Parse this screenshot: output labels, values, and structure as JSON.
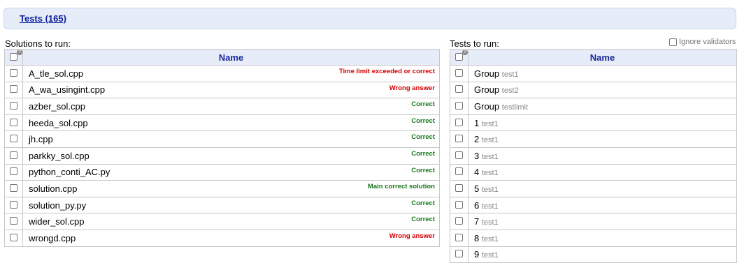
{
  "header": {
    "tests_link": "Tests (165)"
  },
  "solutions": {
    "caption": "Solutions to run:",
    "column_header": "Name",
    "rows": [
      {
        "name": "A_tle_sol.cpp",
        "verdict": "Time limit exceeded or correct",
        "color": "#d40000"
      },
      {
        "name": "A_wa_usingint.cpp",
        "verdict": "Wrong answer",
        "color": "#d40000"
      },
      {
        "name": "azber_sol.cpp",
        "verdict": "Correct",
        "color": "#17751a"
      },
      {
        "name": "heeda_sol.cpp",
        "verdict": "Correct",
        "color": "#17751a"
      },
      {
        "name": "jh.cpp",
        "verdict": "Correct",
        "color": "#17751a"
      },
      {
        "name": "parkky_sol.cpp",
        "verdict": "Correct",
        "color": "#17751a"
      },
      {
        "name": "python_conti_AC.py",
        "verdict": "Correct",
        "color": "#17751a"
      },
      {
        "name": "solution.cpp",
        "verdict": "Main correct solution",
        "color": "#17751a"
      },
      {
        "name": "solution_py.py",
        "verdict": "Correct",
        "color": "#17751a"
      },
      {
        "name": "wider_sol.cpp",
        "verdict": "Correct",
        "color": "#17751a"
      },
      {
        "name": "wrongd.cpp",
        "verdict": "Wrong answer",
        "color": "#d40000"
      }
    ]
  },
  "tests": {
    "caption": "Tests to run:",
    "ignore_validators_label": "Ignore validators",
    "column_header": "Name",
    "rows": [
      {
        "label": "Group",
        "group": "test1"
      },
      {
        "label": "Group",
        "group": "test2"
      },
      {
        "label": "Group",
        "group": "testlimit"
      },
      {
        "label": "1",
        "group": "test1"
      },
      {
        "label": "2",
        "group": "test1"
      },
      {
        "label": "3",
        "group": "test1"
      },
      {
        "label": "4",
        "group": "test1"
      },
      {
        "label": "5",
        "group": "test1"
      },
      {
        "label": "6",
        "group": "test1"
      },
      {
        "label": "7",
        "group": "test1"
      },
      {
        "label": "8",
        "group": "test1"
      },
      {
        "label": "9",
        "group": "test1"
      }
    ]
  }
}
